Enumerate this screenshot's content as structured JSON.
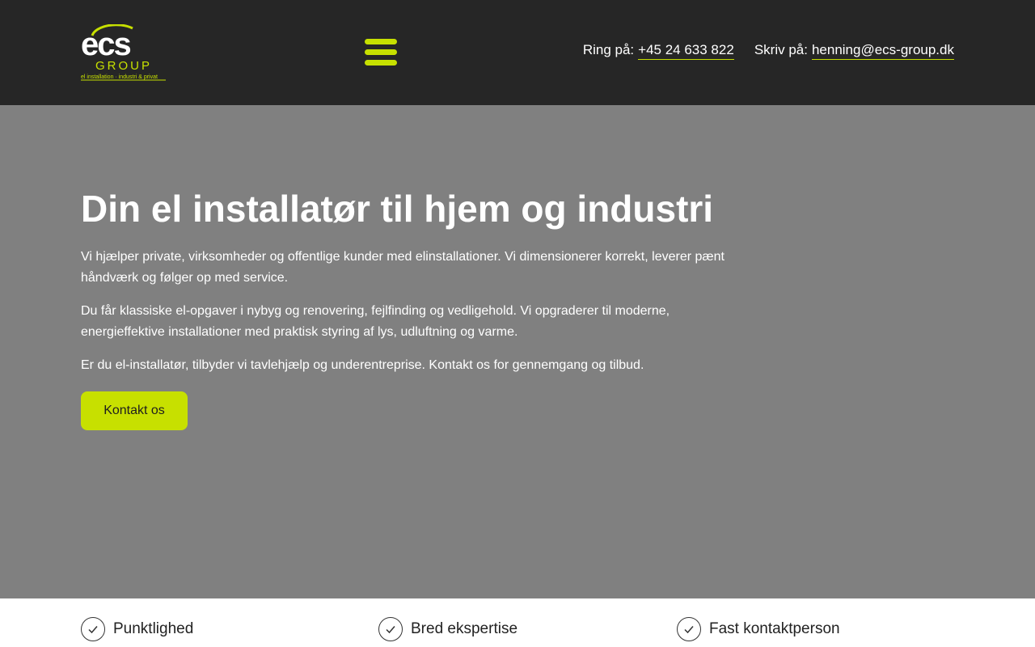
{
  "brand": {
    "logo_main": "ecs",
    "logo_sub": "GROUP",
    "logo_tagline": "el installation · industri & privat",
    "accent_color": "#c7e000",
    "header_bg": "#262626",
    "hero_bg": "#808080"
  },
  "header": {
    "menu_icon": "hamburger-icon",
    "phone_label": "Ring på:",
    "phone": "+45 24 633 822",
    "email_label": "Skriv på:",
    "email": "henning@ecs-group.dk"
  },
  "hero": {
    "title": "Din el installatør til hjem og industri",
    "paragraphs": [
      "Vi hjælper private, virksomheder og offentlige kunder med elinstallationer. Vi dimensionerer korrekt, leverer pænt håndværk og følger op med service.",
      "Du får klassiske el-opgaver i nybyg og renovering, fejlfinding og vedligehold. Vi opgraderer til moderne, energieffektive installationer med praktisk styring af lys, udluftning og varme.",
      "Er du el-installatør, tilbyder vi tavlehjælp og underentreprise. Kontakt os for gennemgang og tilbud."
    ],
    "cta_label": "Kontakt os"
  },
  "features": [
    {
      "icon": "check-circle-icon",
      "label": "Punktlighed"
    },
    {
      "icon": "check-circle-icon",
      "label": "Bred ekspertise"
    },
    {
      "icon": "check-circle-icon",
      "label": "Fast kontaktperson"
    }
  ]
}
